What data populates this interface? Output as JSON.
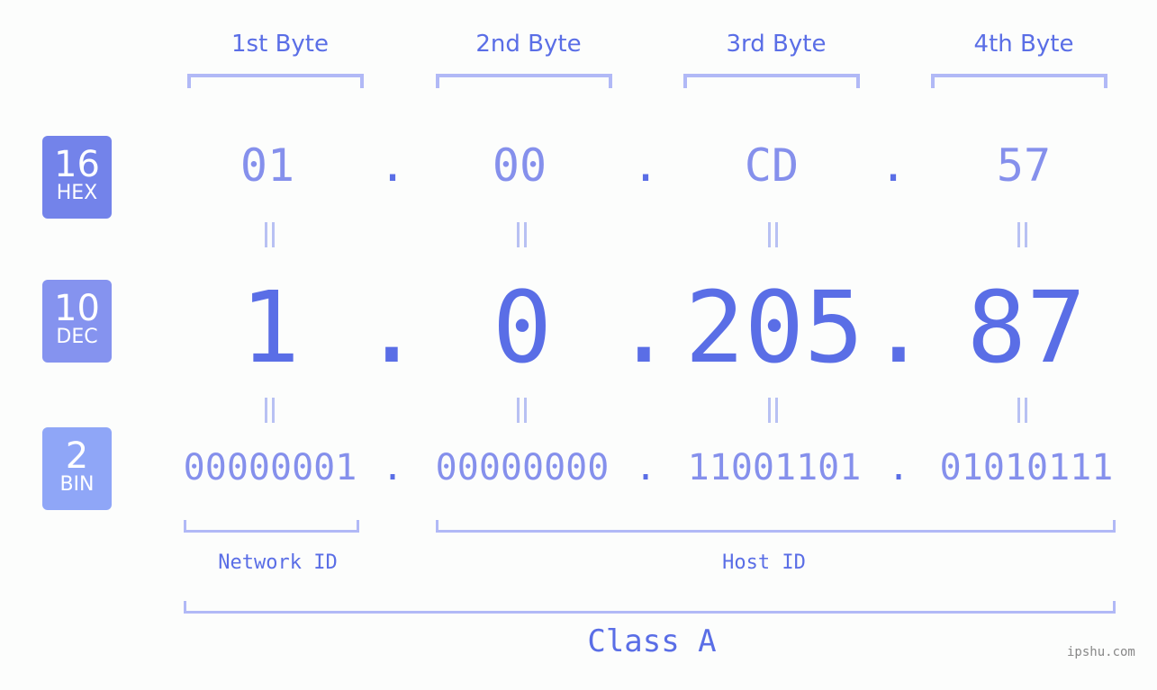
{
  "byte_headers": [
    "1st Byte",
    "2nd Byte",
    "3rd Byte",
    "4th Byte"
  ],
  "badges": {
    "hex": {
      "num": "16",
      "label": "HEX",
      "color": "#7383ea"
    },
    "dec": {
      "num": "10",
      "label": "DEC",
      "color": "#8593ef"
    },
    "bin": {
      "num": "2",
      "label": "BIN",
      "color": "#8fa6f7"
    }
  },
  "hex": [
    "01",
    "00",
    "CD",
    "57"
  ],
  "dec": [
    "1",
    "0",
    "205",
    "87"
  ],
  "bin": [
    "00000001",
    "00000000",
    "11001101",
    "01010111"
  ],
  "separator": ".",
  "network_label": "Network ID",
  "host_label": "Host ID",
  "class_label": "Class A",
  "watermark": "ipshu.com"
}
